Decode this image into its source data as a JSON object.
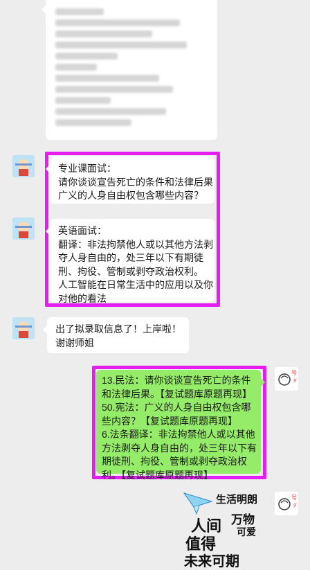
{
  "chat": {
    "top_blurred_block": {},
    "msg_interview_professional": {
      "lines": [
        "专业课面试：",
        "请你谈谈宣告死亡的条件和法律后果",
        "广义的人身自由权包含哪些内容？"
      ]
    },
    "msg_interview_english": {
      "lines": [
        "英语面试：",
        "翻译：非法拘禁他人或以其他方法剥",
        "夺人身自由的，处三年以下有期徒",
        "刑、拘役、管制或剥夺政治权利。",
        "人工智能在日常生活中的应用以及你",
        "对他的看法"
      ]
    },
    "msg_admitted": {
      "lines": [
        "出了拟录取信息了！上岸啦！",
        "谢谢师姐"
      ]
    },
    "msg_reply_green": {
      "lines": [
        "13.民法：请你谈谈宣告死亡的条件",
        "和法律后果。【复试题库原题再现】",
        "50.宪法：广义的人身自由权包含哪",
        "些内容？【复试题库原题再现】",
        "6.法条翻译：非法拘禁他人或以其他",
        "方法剥夺人身自由的，处三年以下有",
        "期徒刑、拘役、管制或剥夺政治权",
        "利。【复试题库原题再现】"
      ]
    },
    "sticker": {
      "text_1": "生活明朗",
      "text_2": "万物",
      "text_3": "可爱",
      "text_4": "人间",
      "text_5": "值得",
      "text_6": "未来可期"
    }
  },
  "colors": {
    "background": "#ededed",
    "bubble_white": "#ffffff",
    "bubble_green": "#95ec69",
    "highlight": "#e41df0"
  }
}
